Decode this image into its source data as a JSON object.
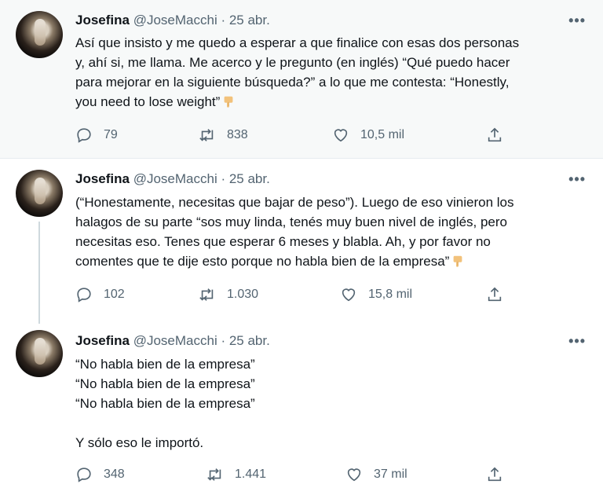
{
  "tweets": [
    {
      "name": "Josefina",
      "handle": "@JoseMacchi",
      "sep": " · ",
      "date": "25 abr.",
      "more": "•••",
      "lines": [
        "Así que insisto y me quedo a esperar a que finalice con esas dos personas",
        "y, ahí si, me llama. Me acerco y le pregunto (en inglés) “Qué puedo hacer",
        "para mejorar en la siguiente búsqueda?” a lo que me contesta: “Honestly,",
        "you need to lose weight”"
      ],
      "emoji": "backhand-index-pointing-down-icon",
      "replies": "79",
      "retweets": "838",
      "likes": "10,5 mil"
    },
    {
      "name": "Josefina",
      "handle": "@JoseMacchi",
      "sep": " · ",
      "date": "25 abr.",
      "more": "•••",
      "lines": [
        "(“Honestamente, necesitas que bajar de peso”). Luego de eso vinieron los",
        "halagos de su parte “sos muy linda, tenés muy buen nivel de inglés, pero",
        "necesitas eso. Tenes que esperar 6 meses y blabla. Ah, y por favor no",
        "comentes que te dije esto porque no habla bien de la empresa”"
      ],
      "emoji": "backhand-index-pointing-down-icon",
      "replies": "102",
      "retweets": "1.030",
      "likes": "15,8 mil"
    },
    {
      "name": "Josefina",
      "handle": "@JoseMacchi",
      "sep": " · ",
      "date": "25 abr.",
      "more": "•••",
      "lines": [
        "“No habla bien de la empresa”",
        "“No habla bien de la empresa”",
        "“No habla bien de la empresa”",
        "",
        "Y sólo eso le importó."
      ],
      "replies": "348",
      "retweets": "1.441",
      "likes": "37 mil"
    }
  ],
  "colors": {
    "text": "#0f1419",
    "muted": "#536471",
    "highlight_bg": "#f7f9f9",
    "thread_line": "#cfd9de"
  }
}
